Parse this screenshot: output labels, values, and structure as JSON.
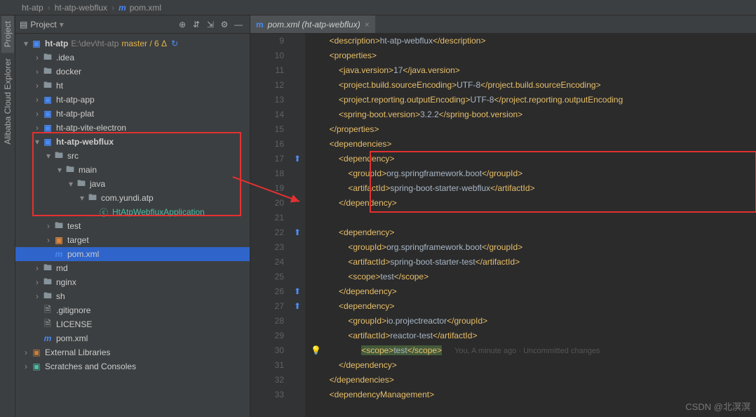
{
  "breadcrumb": {
    "p1": "ht-atp",
    "p2": "ht-atp-webflux",
    "p3": "pom.xml"
  },
  "sidebar": {
    "title": "Project",
    "root": {
      "name": "ht-atp",
      "path": "E:\\dev\\ht-atp",
      "branch": "master / 6 Δ"
    },
    "items": [
      {
        "t": "folder",
        "lbl": ".idea",
        "d": 1
      },
      {
        "t": "folder",
        "lbl": "docker",
        "d": 1
      },
      {
        "t": "folder",
        "lbl": "ht",
        "d": 1
      },
      {
        "t": "mod",
        "lbl": "ht-atp-app",
        "d": 1
      },
      {
        "t": "mod",
        "lbl": "ht-atp-plat",
        "d": 1
      },
      {
        "t": "mod",
        "lbl": "ht-atp-vite-electron",
        "d": 1
      },
      {
        "t": "mod",
        "lbl": "ht-atp-webflux",
        "d": 1,
        "open": true,
        "bold": true
      },
      {
        "t": "folder",
        "lbl": "src",
        "d": 2,
        "open": true
      },
      {
        "t": "folder",
        "lbl": "main",
        "d": 3,
        "open": true
      },
      {
        "t": "folder",
        "lbl": "java",
        "d": 4,
        "open": true
      },
      {
        "t": "folder",
        "lbl": "com.yundi.atp",
        "d": 5,
        "open": true
      },
      {
        "t": "class",
        "lbl": "HtAtpWebfluxApplication",
        "d": 6,
        "hl": true
      },
      {
        "t": "folder",
        "lbl": "test",
        "d": 2
      },
      {
        "t": "orange",
        "lbl": "target",
        "d": 2
      },
      {
        "t": "mvn",
        "lbl": "pom.xml",
        "d": 2,
        "sel": true
      },
      {
        "t": "folder",
        "lbl": "md",
        "d": 1
      },
      {
        "t": "folder",
        "lbl": "nginx",
        "d": 1
      },
      {
        "t": "folder",
        "lbl": "sh",
        "d": 1
      },
      {
        "t": "file",
        "lbl": ".gitignore",
        "d": 1
      },
      {
        "t": "file",
        "lbl": "LICENSE",
        "d": 1
      },
      {
        "t": "mvn",
        "lbl": "pom.xml",
        "d": 1
      }
    ],
    "ext": "External Libraries",
    "scratch": "Scratches and Consoles"
  },
  "rails": {
    "project": "Project",
    "cloud": "Alibaba Cloud Explorer"
  },
  "tab": {
    "name": "pom.xml (ht-atp-webflux)"
  },
  "code": {
    "startLine": 9,
    "lines": [
      [
        {
          "c": "tag",
          "t": "        <description>"
        },
        {
          "c": "text",
          "t": "ht-atp-webflux"
        },
        {
          "c": "tag",
          "t": "</description>"
        }
      ],
      [
        {
          "c": "tag",
          "t": "        <properties>"
        }
      ],
      [
        {
          "c": "tag",
          "t": "            <java.version>"
        },
        {
          "c": "text",
          "t": "17"
        },
        {
          "c": "tag",
          "t": "</java.version>"
        }
      ],
      [
        {
          "c": "tag",
          "t": "            <project.build.sourceEncoding>"
        },
        {
          "c": "text",
          "t": "UTF-8"
        },
        {
          "c": "tag",
          "t": "</project.build.sourceEncoding>"
        }
      ],
      [
        {
          "c": "tag",
          "t": "            <project.reporting.outputEncoding>"
        },
        {
          "c": "text",
          "t": "UTF-8"
        },
        {
          "c": "tag",
          "t": "</project.reporting.outputEncoding"
        }
      ],
      [
        {
          "c": "tag",
          "t": "            <spring-boot.version>"
        },
        {
          "c": "text",
          "t": "3.2.2"
        },
        {
          "c": "tag",
          "t": "</spring-boot.version>"
        }
      ],
      [
        {
          "c": "tag",
          "t": "        </properties>"
        }
      ],
      [
        {
          "c": "tag",
          "t": "        <dependencies>"
        }
      ],
      [
        {
          "c": "tag",
          "t": "            <dependency>"
        }
      ],
      [
        {
          "c": "tag",
          "t": "                <groupId>"
        },
        {
          "c": "text",
          "t": "org.springframework.boot"
        },
        {
          "c": "tag",
          "t": "</groupId>"
        }
      ],
      [
        {
          "c": "tag",
          "t": "                <artifactId>"
        },
        {
          "c": "text",
          "t": "spring-boot-starter-webflux"
        },
        {
          "c": "tag",
          "t": "</artifactId>"
        }
      ],
      [
        {
          "c": "tag",
          "t": "            </dependency>"
        }
      ],
      [
        {
          "c": "text",
          "t": ""
        }
      ],
      [
        {
          "c": "tag",
          "t": "            <dependency>"
        }
      ],
      [
        {
          "c": "tag",
          "t": "                <groupId>"
        },
        {
          "c": "text",
          "t": "org.springframework.boot"
        },
        {
          "c": "tag",
          "t": "</groupId>"
        }
      ],
      [
        {
          "c": "tag",
          "t": "                <artifactId>"
        },
        {
          "c": "text",
          "t": "spring-boot-starter-test"
        },
        {
          "c": "tag",
          "t": "</artifactId>"
        }
      ],
      [
        {
          "c": "tag",
          "t": "                <scope>"
        },
        {
          "c": "text",
          "t": "test"
        },
        {
          "c": "tag",
          "t": "</scope>"
        }
      ],
      [
        {
          "c": "tag",
          "t": "            </dependency>"
        }
      ],
      [
        {
          "c": "tag",
          "t": "            <dependency>"
        }
      ],
      [
        {
          "c": "tag",
          "t": "                <groupId>"
        },
        {
          "c": "text",
          "t": "io.projectreactor"
        },
        {
          "c": "tag",
          "t": "</groupId>"
        }
      ],
      [
        {
          "c": "tag",
          "t": "                <artifactId>"
        },
        {
          "c": "text",
          "t": "reactor-test"
        },
        {
          "c": "tag",
          "t": "</artifactId>"
        }
      ],
      [
        {
          "c": "tag",
          "t": "                "
        },
        {
          "c": "tag hl",
          "t": "<scope>"
        },
        {
          "c": "text hl",
          "t": "test"
        },
        {
          "c": "tag hl",
          "t": "</scope>"
        }
      ],
      [
        {
          "c": "tag",
          "t": "            </dependency>"
        }
      ],
      [
        {
          "c": "tag",
          "t": "        </dependencies>"
        }
      ],
      [
        {
          "c": "tag",
          "t": "        <dependencyManagement>"
        }
      ]
    ],
    "annotation": "You, A minute ago · Uncommitted changes"
  },
  "watermark": "CSDN @北溟溟"
}
